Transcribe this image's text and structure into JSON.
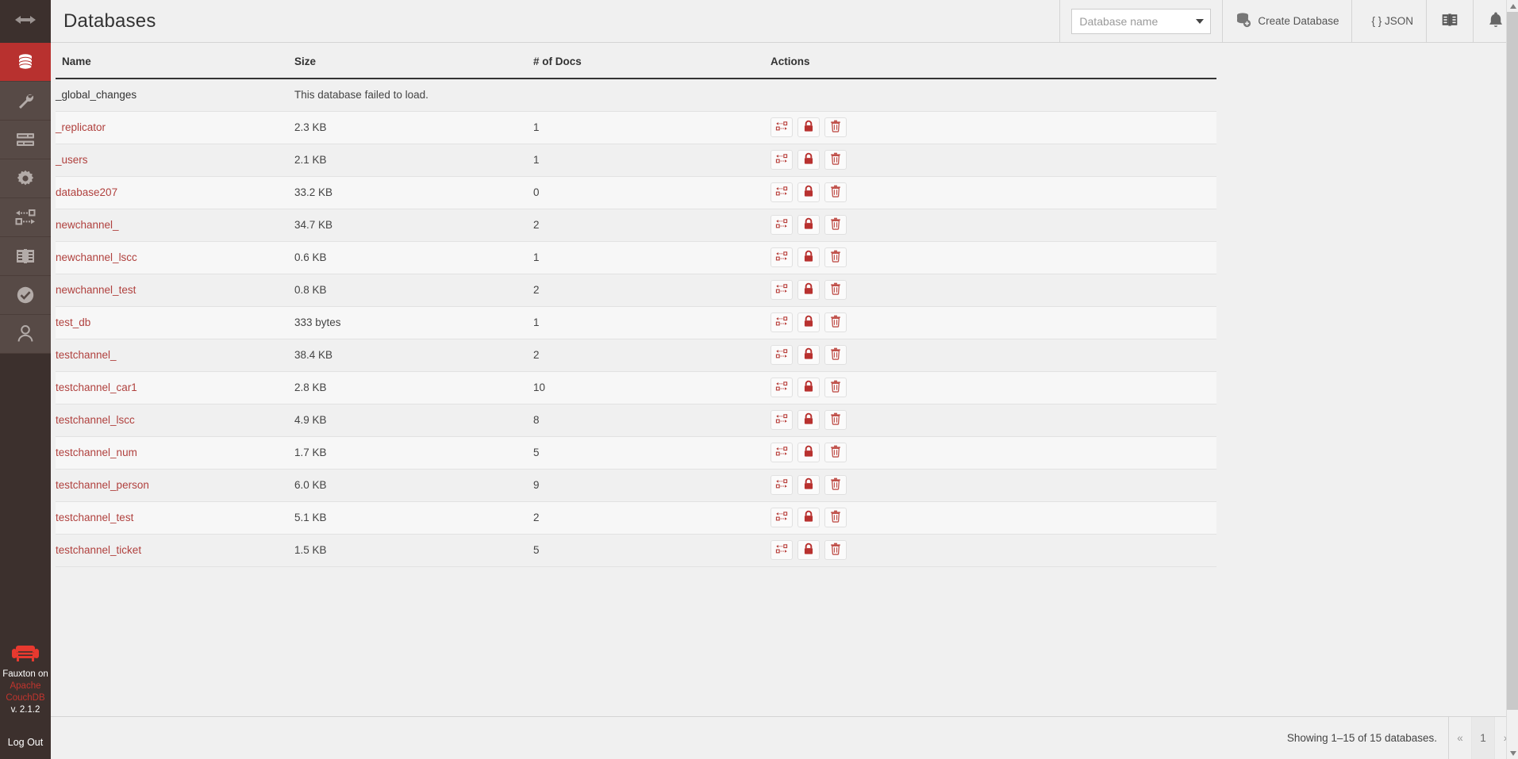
{
  "sidebar": {
    "toggle_icon": "expand-arrows-icon",
    "items": [
      {
        "icon": "database-icon",
        "label": "Databases",
        "active": true
      },
      {
        "icon": "wrench-icon",
        "label": "Setup",
        "active": false
      },
      {
        "icon": "server-list-icon",
        "label": "Active Tasks",
        "active": false
      },
      {
        "icon": "gear-icon",
        "label": "Configuration",
        "active": false
      },
      {
        "icon": "replication-icon",
        "label": "Replication",
        "active": false
      },
      {
        "icon": "book-icon",
        "label": "Documentation",
        "active": false
      },
      {
        "icon": "check-circle-icon",
        "label": "Verify",
        "active": false
      },
      {
        "icon": "user-icon",
        "label": "Account",
        "active": false
      }
    ],
    "brand": {
      "logo_icon": "couch-icon",
      "line1": "Fauxton on",
      "line2": "Apache CouchDB",
      "line3": "v. 2.1.2"
    },
    "logout_label": "Log Out"
  },
  "header": {
    "title": "Databases",
    "search": {
      "placeholder": "Database name",
      "value": "",
      "dropdown_icon": "caret-down-icon"
    },
    "create_database": {
      "label": "Create Database",
      "icon": "database-add-icon"
    },
    "json": {
      "label": "{ } JSON",
      "icon": "json-icon"
    },
    "docs": {
      "label": "",
      "icon": "book-icon"
    },
    "notifications": {
      "label": "",
      "icon": "bell-icon"
    }
  },
  "table": {
    "columns": [
      "Name",
      "Size",
      "# of Docs",
      "Actions"
    ],
    "action_icons": [
      "replicate-icon",
      "lock-icon",
      "trash-icon"
    ],
    "rows": [
      {
        "name": "_global_changes",
        "size": "This database failed to load.",
        "docs": "",
        "failed": true,
        "link": false,
        "actions": false
      },
      {
        "name": "_replicator",
        "size": "2.3 KB",
        "docs": "1",
        "failed": false,
        "link": true,
        "actions": true
      },
      {
        "name": "_users",
        "size": "2.1 KB",
        "docs": "1",
        "failed": false,
        "link": true,
        "actions": true
      },
      {
        "name": "database207",
        "size": "33.2 KB",
        "docs": "0",
        "failed": false,
        "link": true,
        "actions": true
      },
      {
        "name": "newchannel_",
        "size": "34.7 KB",
        "docs": "2",
        "failed": false,
        "link": true,
        "actions": true
      },
      {
        "name": "newchannel_lscc",
        "size": "0.6 KB",
        "docs": "1",
        "failed": false,
        "link": true,
        "actions": true
      },
      {
        "name": "newchannel_test",
        "size": "0.8 KB",
        "docs": "2",
        "failed": false,
        "link": true,
        "actions": true
      },
      {
        "name": "test_db",
        "size": "333 bytes",
        "docs": "1",
        "failed": false,
        "link": true,
        "actions": true
      },
      {
        "name": "testchannel_",
        "size": "38.4 KB",
        "docs": "2",
        "failed": false,
        "link": true,
        "actions": true
      },
      {
        "name": "testchannel_car1",
        "size": "2.8 KB",
        "docs": "10",
        "failed": false,
        "link": true,
        "actions": true
      },
      {
        "name": "testchannel_lscc",
        "size": "4.9 KB",
        "docs": "8",
        "failed": false,
        "link": true,
        "actions": true
      },
      {
        "name": "testchannel_num",
        "size": "1.7 KB",
        "docs": "5",
        "failed": false,
        "link": true,
        "actions": true
      },
      {
        "name": "testchannel_person",
        "size": "6.0 KB",
        "docs": "9",
        "failed": false,
        "link": true,
        "actions": true
      },
      {
        "name": "testchannel_test",
        "size": "5.1 KB",
        "docs": "2",
        "failed": false,
        "link": true,
        "actions": true
      },
      {
        "name": "testchannel_ticket",
        "size": "1.5 KB",
        "docs": "5",
        "failed": false,
        "link": true,
        "actions": true
      }
    ]
  },
  "footer": {
    "showing_text": "Showing 1–15 of 15 databases.",
    "pagination": [
      {
        "label": "«",
        "current": false,
        "name": "prev-page"
      },
      {
        "label": "1",
        "current": true,
        "name": "page-1"
      },
      {
        "label": "»",
        "current": false,
        "name": "next-page"
      }
    ]
  },
  "colors": {
    "sidebar_bg": "#3c302d",
    "sidebar_nav_bg": "#574a46",
    "accent_red": "#b8312f",
    "link_red": "#b0413e",
    "row_even": "#f0f0f0",
    "row_odd": "#f7f7f7",
    "header_bg": "#f0f0f0"
  }
}
